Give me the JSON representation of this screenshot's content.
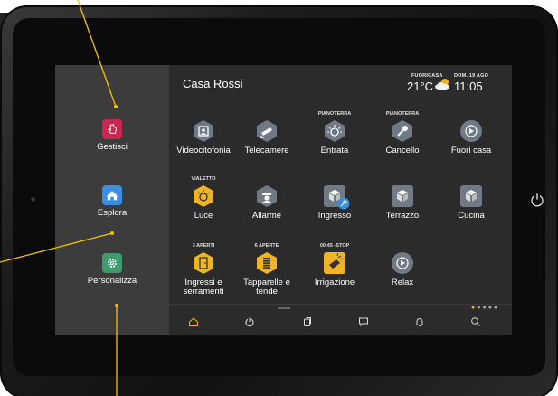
{
  "home": {
    "title": "Casa Rossi"
  },
  "status": {
    "outside_label": "FUORICASA",
    "temperature": "21°C",
    "date_label": "DOM. 19 AGO",
    "time": "11:05"
  },
  "sidebar": {
    "items": [
      {
        "label": "Gestisci",
        "color": "#c8284f"
      },
      {
        "label": "Esplora",
        "color": "#3b8ee0"
      },
      {
        "label": "Personalizza",
        "color": "#3f9a6e"
      }
    ]
  },
  "tiles": [
    {
      "caption": "",
      "label": "Videocitofonia",
      "icon": "intercom-icon"
    },
    {
      "caption": "",
      "label": "Telecamere",
      "icon": "camera-icon"
    },
    {
      "caption": "PIANOTERRA",
      "label": "Entrata",
      "icon": "light-icon"
    },
    {
      "caption": "PIANOTERRA",
      "label": "Cancello",
      "icon": "gate-icon"
    },
    {
      "caption": "",
      "label": "Fuori casa",
      "icon": "scenario-icon"
    },
    {
      "caption": "VIALETTO",
      "label": "Luce",
      "icon": "light-on-icon"
    },
    {
      "caption": "",
      "label": "Allarme",
      "icon": "alarm-icon"
    },
    {
      "caption": "",
      "label": "Ingresso",
      "icon": "door-lock-icon"
    },
    {
      "caption": "",
      "label": "Terrazzo",
      "icon": "cube-icon"
    },
    {
      "caption": "",
      "label": "Cucina",
      "icon": "cube-icon"
    },
    {
      "caption": "3 APERTI",
      "label": "Ingressi e serramenti",
      "icon": "door-icon"
    },
    {
      "caption": "6 APERTE",
      "label": "Tapparelle e tende",
      "icon": "shutter-icon"
    },
    {
      "caption": "00:45 -STOP",
      "label": "Irrigazione",
      "icon": "irrigation-icon"
    },
    {
      "caption": "",
      "label": "Relax",
      "icon": "scenario-icon"
    }
  ],
  "tabbar": [
    "home-icon",
    "power-icon",
    "copy-icon",
    "chat-icon",
    "bell-icon",
    "search-icon"
  ],
  "colors": {
    "accent": "#f0b324",
    "tile_grey": "#6f7a86",
    "screen_bg": "#2b2b2b"
  }
}
